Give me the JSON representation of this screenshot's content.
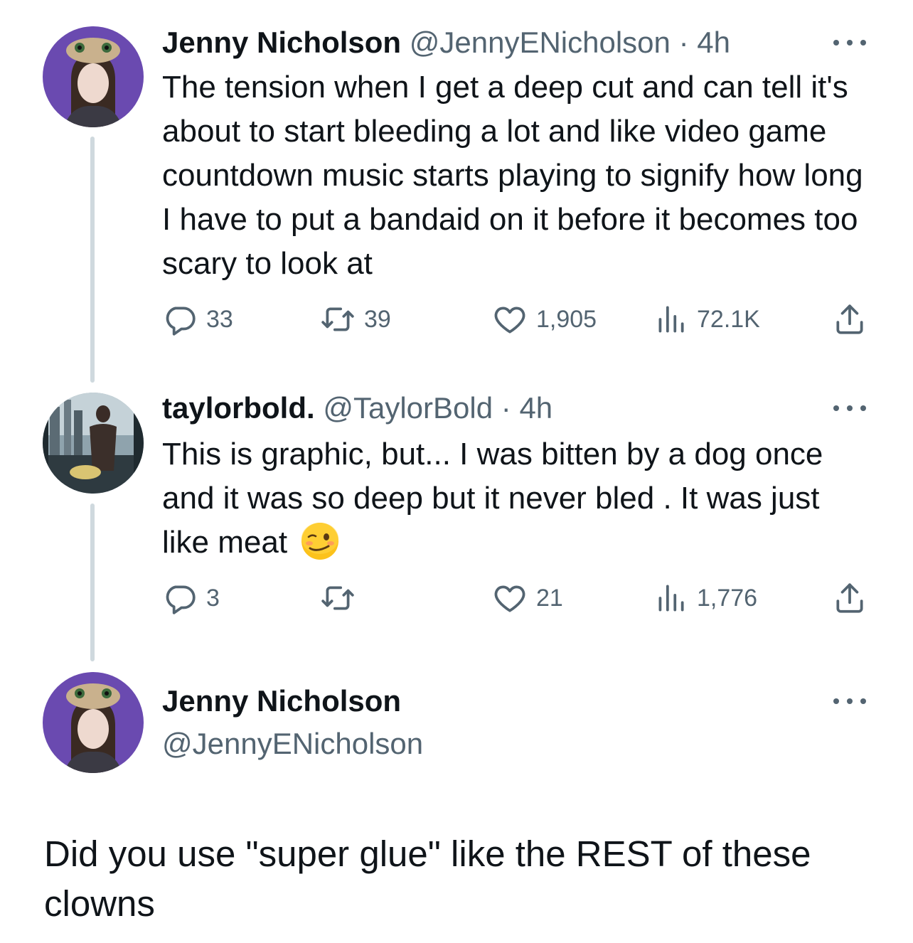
{
  "tweets": [
    {
      "author_name": "Jenny Nicholson",
      "handle": "@JennyENicholson",
      "separator": "·",
      "time": "4h",
      "text": "The tension when I get a deep cut and can tell it's about to start bleeding a lot and like video game countdown music starts playing to signify how long I have to put a bandaid on it before it becomes too scary to look at",
      "replies": "33",
      "retweets": "39",
      "likes": "1,905",
      "views": "72.1K"
    },
    {
      "author_name": "taylorbold.",
      "handle": "@TaylorBold",
      "separator": "·",
      "time": "4h",
      "text": "This is graphic, but... I was bitten by a dog once and it was so deep but it never bled . It was just like meat",
      "emoji": "woozy-face",
      "replies": "3",
      "retweets": "",
      "likes": "21",
      "views": "1,776"
    },
    {
      "author_name": "Jenny Nicholson",
      "handle": "@JennyENicholson",
      "text": "Did you use \"super glue\" like the REST of these clowns"
    }
  ],
  "icons": {
    "reply": "reply-icon",
    "retweet": "retweet-icon",
    "like": "heart-icon",
    "views": "views-icon",
    "share": "share-icon",
    "more": "more-icon"
  },
  "colors": {
    "text": "#0f1419",
    "secondary": "#536471",
    "thread_line": "#cfd9de",
    "avatar_jenny_bg": "#6a4ab0"
  }
}
